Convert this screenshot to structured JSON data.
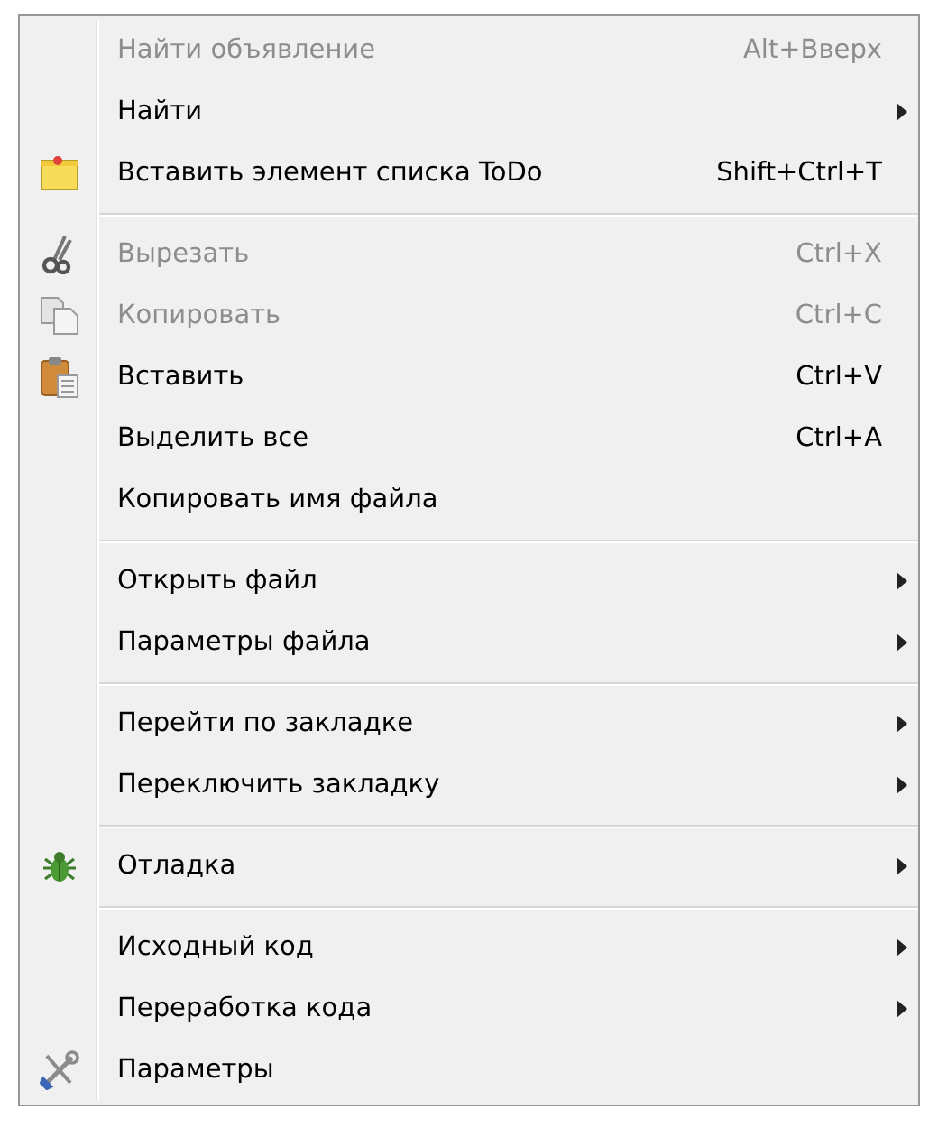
{
  "menu": {
    "groups": [
      {
        "items": [
          {
            "label": "Найти объявление",
            "shortcut": "Alt+Вверх",
            "disabled": true,
            "submenu": false
          },
          {
            "label": "Найти",
            "disabled": false,
            "submenu": true
          },
          {
            "label": "Вставить элемент списка ToDo",
            "shortcut": "Shift+Ctrl+T",
            "disabled": false,
            "submenu": false,
            "kind": "note"
          }
        ]
      },
      {
        "items": [
          {
            "label": "Вырезать",
            "shortcut": "Ctrl+X",
            "disabled": true,
            "submenu": false,
            "kind": "scissors"
          },
          {
            "label": "Копировать",
            "shortcut": "Ctrl+C",
            "disabled": true,
            "submenu": false,
            "kind": "copy"
          },
          {
            "label": "Вставить",
            "shortcut": "Ctrl+V",
            "disabled": false,
            "submenu": false,
            "kind": "paste"
          },
          {
            "label": "Выделить все",
            "shortcut": "Ctrl+A",
            "disabled": false,
            "submenu": false
          },
          {
            "label": "Копировать имя файла",
            "disabled": false,
            "submenu": false
          }
        ]
      },
      {
        "items": [
          {
            "label": "Открыть файл",
            "disabled": false,
            "submenu": true
          },
          {
            "label": "Параметры файла",
            "disabled": false,
            "submenu": true
          }
        ]
      },
      {
        "items": [
          {
            "label": "Перейти по закладке",
            "disabled": false,
            "submenu": true
          },
          {
            "label": "Переключить закладку",
            "disabled": false,
            "submenu": true
          }
        ]
      },
      {
        "items": [
          {
            "label": "Отладка",
            "disabled": false,
            "submenu": true,
            "kind": "bug"
          }
        ]
      },
      {
        "items": [
          {
            "label": "Исходный код",
            "disabled": false,
            "submenu": true
          },
          {
            "label": "Переработка кода",
            "disabled": false,
            "submenu": true
          },
          {
            "label": "Параметры",
            "disabled": false,
            "submenu": false,
            "kind": "tools"
          }
        ]
      }
    ]
  }
}
